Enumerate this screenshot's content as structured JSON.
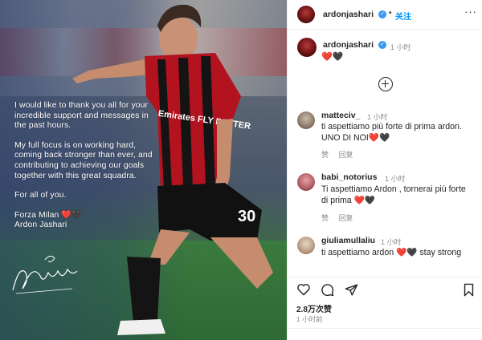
{
  "post_image": {
    "statement_lines": [
      "I would like to thank you all for your incredible support and messages in the past hours.",
      "My full focus is on working hard, coming back stronger than ever, and contributing to achieving our goals together with this great squadra.",
      "For all of you.",
      "Forza Milan ❤️🖤",
      "Ardon Jashari"
    ],
    "shirt_sponsor": "Emirates FLY BETTER",
    "shirt_number": "30"
  },
  "header": {
    "username": "ardonjashari",
    "follow_label": "关注",
    "more_label": "···"
  },
  "caption": {
    "username": "ardonjashari",
    "time": "1 小时",
    "text": "❤️🖤"
  },
  "comments": [
    {
      "username": "matteciv_",
      "time": "1 小时",
      "text": "ti aspettiamo più forte di prima ardon. UNO DI NOI❤️🖤",
      "like_label": "赞",
      "reply_label": "回复"
    },
    {
      "username": "babi_notorius",
      "time": "1 小时",
      "text": "Ti aspettiamo Ardon , tornerai più forte di prima ❤️🖤",
      "like_label": "赞",
      "reply_label": "回复"
    },
    {
      "username": "giuliamullaliu",
      "time": "1 小时",
      "text": "ti aspettiamo ardon ❤️🖤 stay strong"
    }
  ],
  "footer": {
    "likes": "2.8万次赞",
    "posted": "1 小时前"
  },
  "icons": [
    "heart-icon",
    "comment-icon",
    "share-icon",
    "bookmark-icon",
    "add-comment-icon",
    "verified-icon"
  ],
  "colors": {
    "accent": "#0095f6",
    "verified": "#3897f0",
    "milan_red": "#c8102e"
  }
}
